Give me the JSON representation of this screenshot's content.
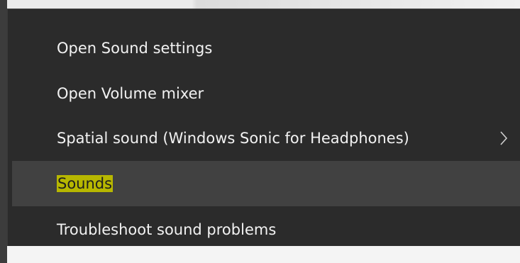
{
  "context_menu": {
    "items": [
      {
        "label": "Open Sound settings",
        "highlighted": false,
        "has_submenu": false
      },
      {
        "label": "Open Volume mixer",
        "highlighted": false,
        "has_submenu": false
      },
      {
        "label": "Spatial sound (Windows Sonic for Headphones)",
        "highlighted": false,
        "has_submenu": true
      },
      {
        "label": "Sounds",
        "highlighted": true,
        "has_submenu": false
      },
      {
        "label": "Troubleshoot sound problems",
        "highlighted": false,
        "has_submenu": false
      }
    ]
  },
  "colors": {
    "menu_background": "#2b2b2b",
    "hover_background": "#414141",
    "text": "#f2f2f2",
    "marker_highlight": "#b7b700"
  }
}
